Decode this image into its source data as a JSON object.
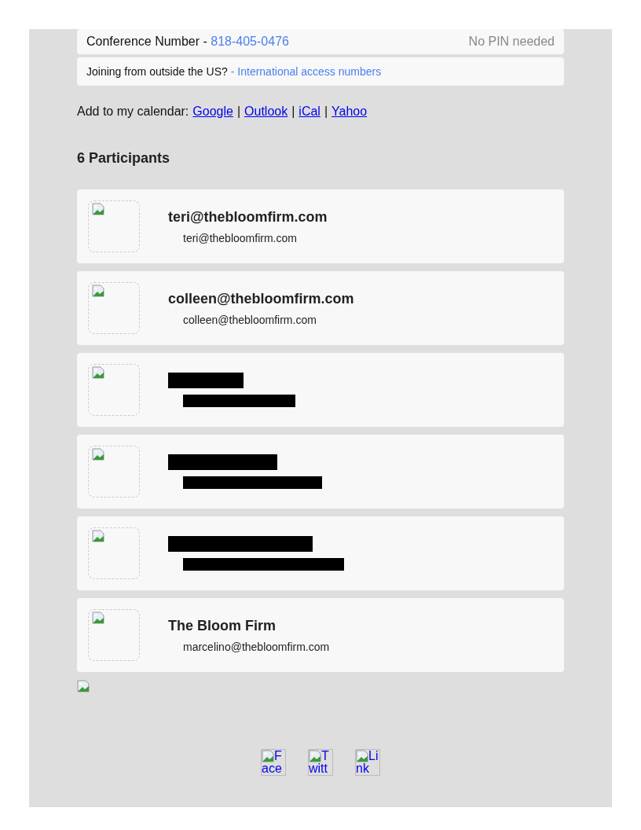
{
  "conference": {
    "label": "Conference Number - ",
    "number": "818-405-0476",
    "pin_note": "No PIN needed"
  },
  "international": {
    "question": "Joining from outside the US?",
    "link": "- International access numbers"
  },
  "calendar": {
    "label": "Add to my calendar:",
    "links": [
      "Google",
      "Outlook",
      "iCal",
      "Yahoo"
    ],
    "separators": [
      "|",
      "|",
      "|"
    ]
  },
  "participants_heading": "6 Participants",
  "participants": [
    {
      "kind": "named",
      "name": "teri@thebloomfirm.com",
      "email": "teri@thebloomfirm.com"
    },
    {
      "kind": "named",
      "name": "colleen@thebloomfirm.com",
      "email": "colleen@thebloomfirm.com"
    },
    {
      "kind": "redacted"
    },
    {
      "kind": "redacted"
    },
    {
      "kind": "redacted"
    },
    {
      "kind": "named",
      "name": "The Bloom Firm",
      "email": "marcelino@thebloomfirm.com"
    }
  ],
  "social_links": [
    {
      "alt": "Face"
    },
    {
      "alt": "Twitt"
    },
    {
      "alt": "Link"
    }
  ]
}
